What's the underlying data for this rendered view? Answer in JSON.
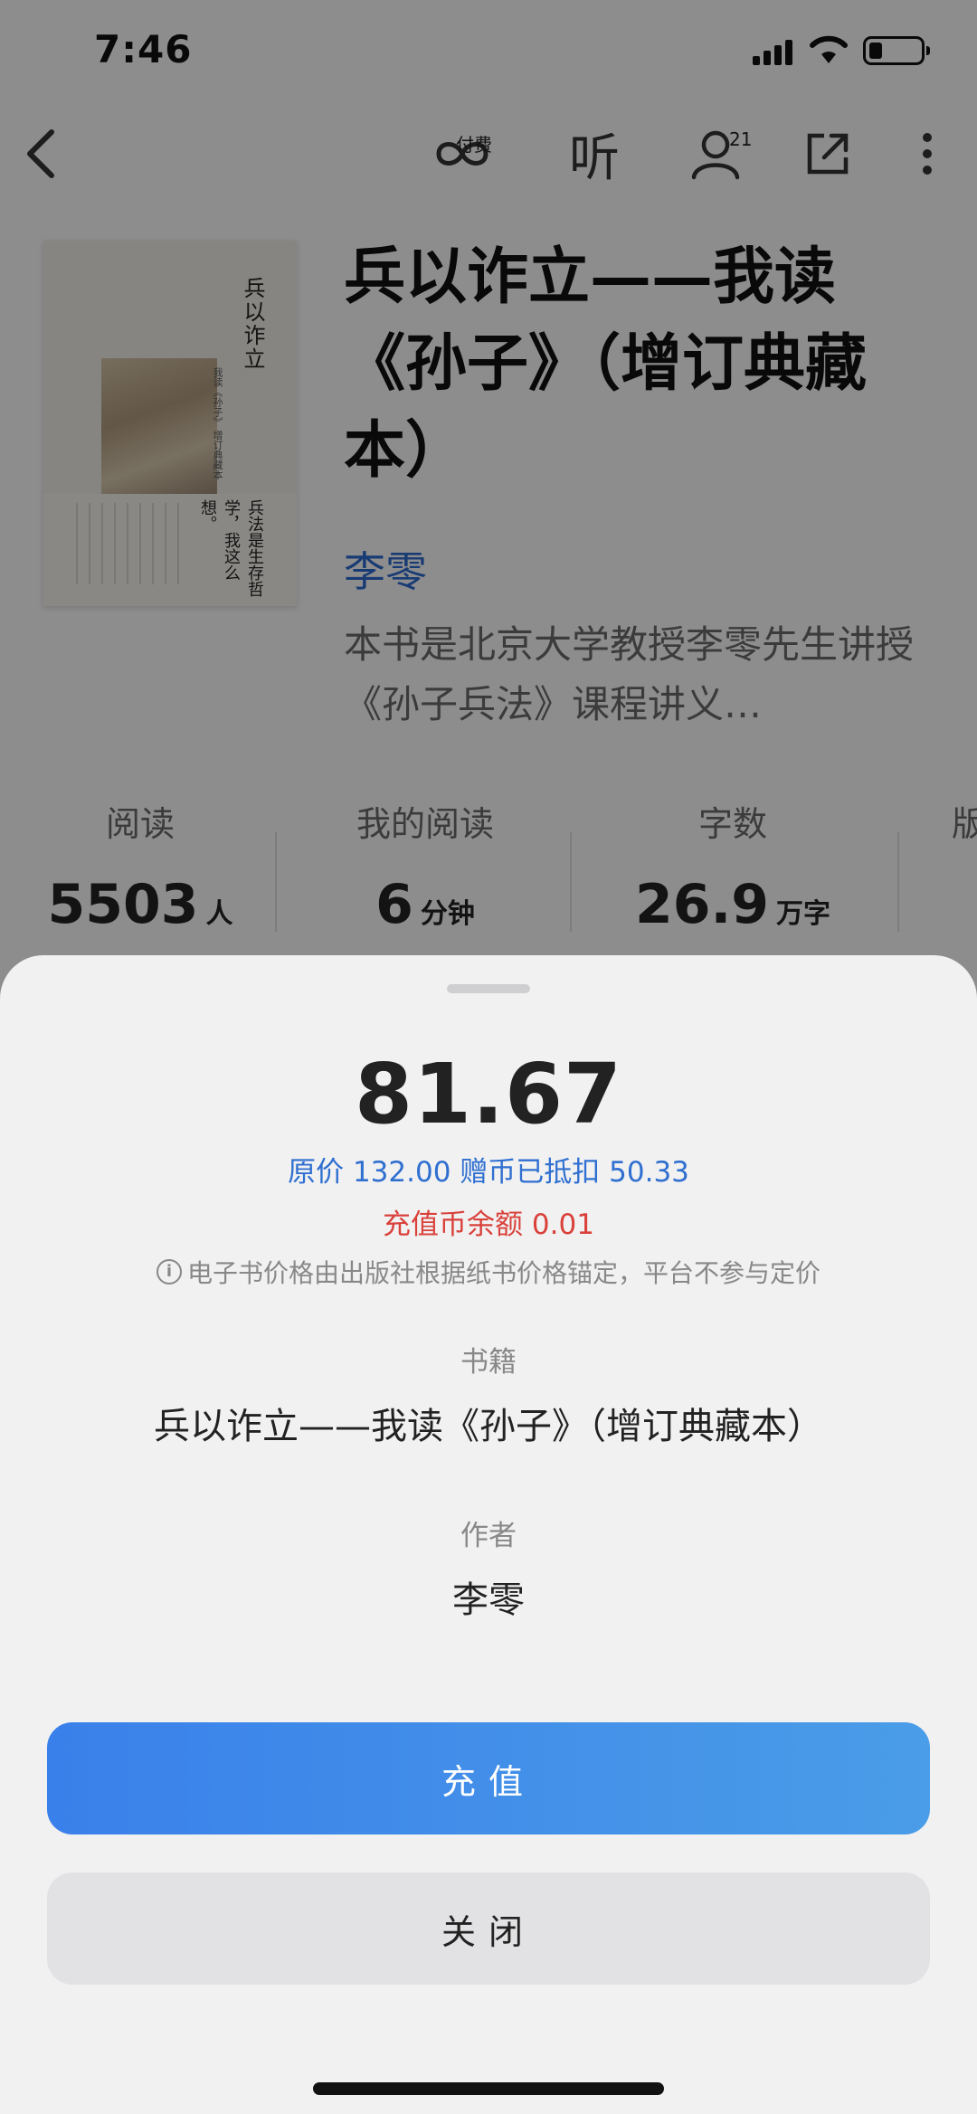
{
  "status_bar": {
    "time": "7:46"
  },
  "nav": {
    "paid_badge": "付费",
    "listen_label": "听",
    "readers_count": "21"
  },
  "book": {
    "title": "兵以诈立——我读《孙子》（增订典藏本）",
    "author": "李零",
    "description": "本书是北京大学教授李零先生讲授《孙子兵法》课程讲义…",
    "cover": {
      "title": "兵以诈立",
      "subtitle": "我读《孙子》 增订典藏本",
      "slogan": "兵法是生存哲学，我这么想。"
    }
  },
  "stats": [
    {
      "label": "阅读",
      "value": "5503",
      "unit": "人"
    },
    {
      "label": "我的阅读",
      "value": "6",
      "unit": "分钟"
    },
    {
      "label": "字数",
      "value": "26.9",
      "unit": "万字"
    },
    {
      "label": "版"
    }
  ],
  "sheet": {
    "price": "81.67",
    "price_detail": "原价 132.00 赠币已抵扣 50.33",
    "balance": "充值币余额 0.01",
    "notice_icon": "i",
    "notice": "电子书价格由出版社根据纸书价格锚定，平台不参与定价",
    "book_label": "书籍",
    "book_value": "兵以诈立——我读《孙子》（增订典藏本）",
    "author_label": "作者",
    "author_value": "李零",
    "recharge_button": "充值",
    "close_button": "关闭"
  },
  "colors": {
    "accent_blue": "#3a80ea",
    "price_blue": "#2f6fd0",
    "balance_red": "#d9413a"
  }
}
